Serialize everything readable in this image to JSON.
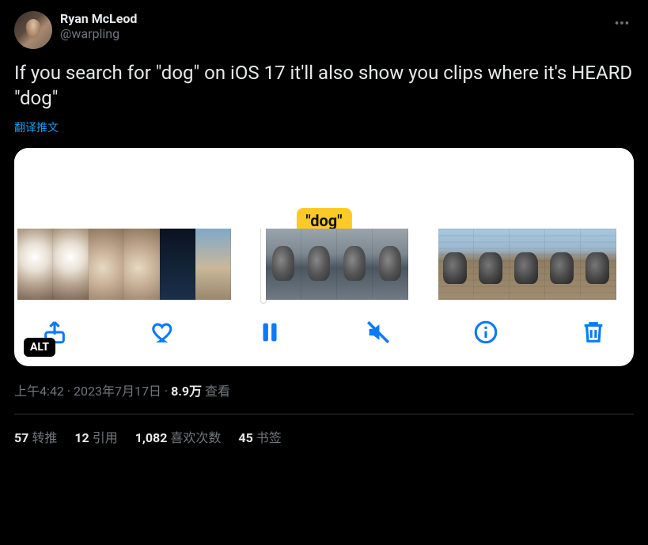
{
  "author": {
    "display_name": "Ryan McLeod",
    "handle": "@warpling"
  },
  "body": "If you search for \"dog\" on iOS 17 it'll also show you clips where it's HEARD \"dog\"",
  "translate_label": "翻译推文",
  "media": {
    "pill_label": "\"dog\"",
    "alt_badge": "ALT",
    "toolbar": {
      "share": "share",
      "like": "like",
      "pause": "pause",
      "mute": "mute",
      "info": "info",
      "delete": "delete"
    }
  },
  "meta": {
    "time": "上午4:42",
    "date": "2023年7月17日",
    "views_number": "8.9万",
    "views_label": "查看"
  },
  "stats": {
    "retweets_n": "57",
    "retweets_label": "转推",
    "quotes_n": "12",
    "quotes_label": "引用",
    "likes_n": "1,082",
    "likes_label": "喜欢次数",
    "bookmarks_n": "45",
    "bookmarks_label": "书签"
  }
}
